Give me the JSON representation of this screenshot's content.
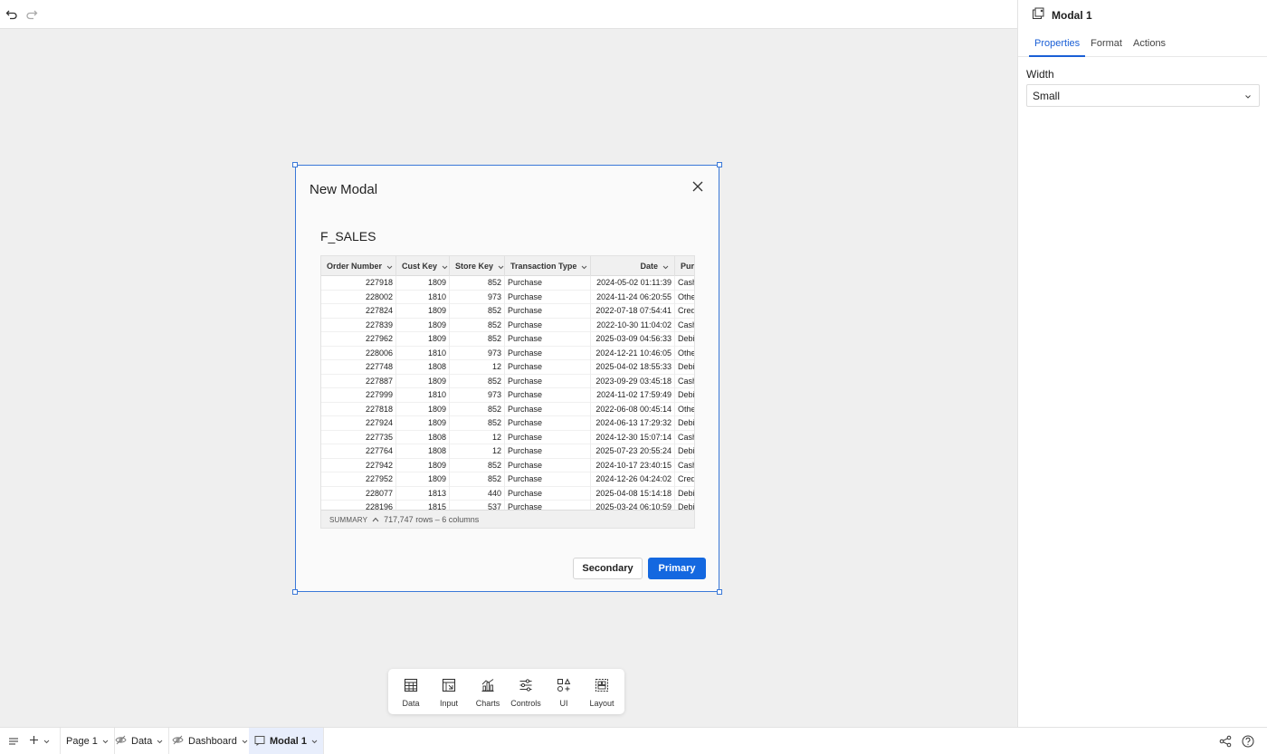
{
  "toolbar_top": {
    "undo_icon": "undo-icon",
    "redo_icon": "redo-icon"
  },
  "right_panel": {
    "title": "Modal 1",
    "tabs": [
      {
        "label": "Properties",
        "active": true
      },
      {
        "label": "Format",
        "active": false
      },
      {
        "label": "Actions",
        "active": false
      }
    ],
    "width_label": "Width",
    "width_value": "Small"
  },
  "modal": {
    "title": "New Modal",
    "table_title": "F_SALES",
    "columns": [
      "Order Number",
      "Cust Key",
      "Store Key",
      "Transaction Type",
      "Date",
      "Purc"
    ],
    "rows": [
      [
        "227918",
        "1809",
        "852",
        "Purchase",
        "2024-05-02 01:11:39",
        "Cash"
      ],
      [
        "228002",
        "1810",
        "973",
        "Purchase",
        "2024-11-24 06:20:55",
        "Other"
      ],
      [
        "227824",
        "1809",
        "852",
        "Purchase",
        "2022-07-18 07:54:41",
        "Credit"
      ],
      [
        "227839",
        "1809",
        "852",
        "Purchase",
        "2022-10-30 11:04:02",
        "Cash"
      ],
      [
        "227962",
        "1809",
        "852",
        "Purchase",
        "2025-03-09 04:56:33",
        "Debit"
      ],
      [
        "228006",
        "1810",
        "973",
        "Purchase",
        "2024-12-21 10:46:05",
        "Other"
      ],
      [
        "227748",
        "1808",
        "12",
        "Purchase",
        "2025-04-02 18:55:33",
        "Debit"
      ],
      [
        "227887",
        "1809",
        "852",
        "Purchase",
        "2023-09-29 03:45:18",
        "Cash"
      ],
      [
        "227999",
        "1810",
        "973",
        "Purchase",
        "2024-11-02 17:59:49",
        "Debit"
      ],
      [
        "227818",
        "1809",
        "852",
        "Purchase",
        "2022-06-08 00:45:14",
        "Other"
      ],
      [
        "227924",
        "1809",
        "852",
        "Purchase",
        "2024-06-13 17:29:32",
        "Debit"
      ],
      [
        "227735",
        "1808",
        "12",
        "Purchase",
        "2024-12-30 15:07:14",
        "Cash"
      ],
      [
        "227764",
        "1808",
        "12",
        "Purchase",
        "2025-07-23 20:55:24",
        "Debit"
      ],
      [
        "227942",
        "1809",
        "852",
        "Purchase",
        "2024-10-17 23:40:15",
        "Cash"
      ],
      [
        "227952",
        "1809",
        "852",
        "Purchase",
        "2024-12-26 04:24:02",
        "Credit"
      ],
      [
        "228077",
        "1813",
        "440",
        "Purchase",
        "2025-04-08 15:14:18",
        "Debit"
      ],
      [
        "228196",
        "1815",
        "537",
        "Purchase",
        "2025-03-24 06:10:59",
        "Debit"
      ]
    ],
    "summary_label": "SUMMARY",
    "summary_text": "717,747 rows – 6 columns",
    "secondary_label": "Secondary",
    "primary_label": "Primary",
    "colors": {
      "accent": "#1468e0",
      "selection": "#3a78d8"
    }
  },
  "element_toolbar": [
    {
      "label": "Data",
      "icon": "table-icon"
    },
    {
      "label": "Input",
      "icon": "input-icon"
    },
    {
      "label": "Charts",
      "icon": "chart-icon"
    },
    {
      "label": "Controls",
      "icon": "sliders-icon"
    },
    {
      "label": "UI",
      "icon": "shapes-icon"
    },
    {
      "label": "Layout",
      "icon": "layout-icon"
    }
  ],
  "bottom_bar": {
    "tabs": [
      {
        "label": "Page 1",
        "hidden": false,
        "active": false
      },
      {
        "label": "Data",
        "hidden": true,
        "active": false
      },
      {
        "label": "Dashboard",
        "hidden": true,
        "active": false
      },
      {
        "label": "Modal 1",
        "hidden": false,
        "active": true
      }
    ]
  }
}
